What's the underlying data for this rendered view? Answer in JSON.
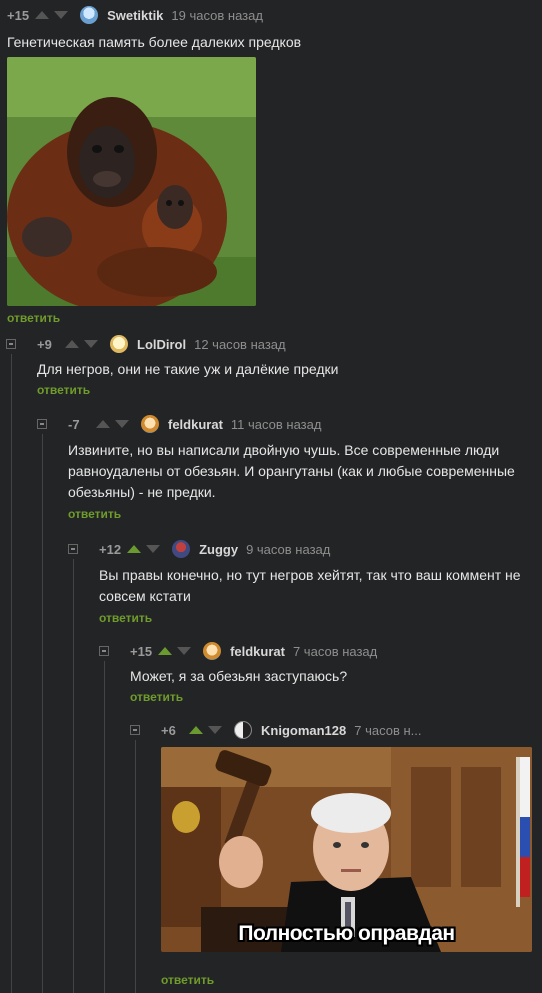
{
  "comments": [
    {
      "rating": "+15",
      "user": "Swetiktik",
      "time": "19 часов назад",
      "text": "Генетическая память более далеких предков",
      "reply": "ответить"
    },
    {
      "rating": "+9",
      "user": "LolDirol",
      "time": "12 часов назад",
      "text": "Для негров, они не такие уж и далёкие предки",
      "reply": "ответить"
    },
    {
      "rating": "-7",
      "user": "feldkurat",
      "time": "11 часов назад",
      "text": "Извините, но вы написали двойную чушь. Все современные люди равноудалены от обезьян. И орангутаны (как и любые современные обезьяны) - не предки.",
      "reply": "ответить"
    },
    {
      "rating": "+12",
      "user": "Zuggy",
      "time": "9 часов назад",
      "text": "Вы правы конечно, но тут негров хейтят, так что ваш коммент не совсем кстати",
      "reply": "ответить"
    },
    {
      "rating": "+15",
      "user": "feldkurat",
      "time": "7 часов назад",
      "text": "Может, я за обезьян заступаюсь?",
      "reply": "ответить"
    },
    {
      "rating": "+6",
      "user": "Knigoman128",
      "time": "7 часов н...",
      "image_caption": "Полностью оправдан",
      "reply": "ответить"
    }
  ],
  "colors": {
    "background": "#232426",
    "reply_green": "#6f9c2b",
    "upvote_active": "#6a9a30"
  },
  "icons": [
    "arrow-up-icon",
    "arrow-down-icon",
    "collapse-icon",
    "avatar-icon"
  ]
}
